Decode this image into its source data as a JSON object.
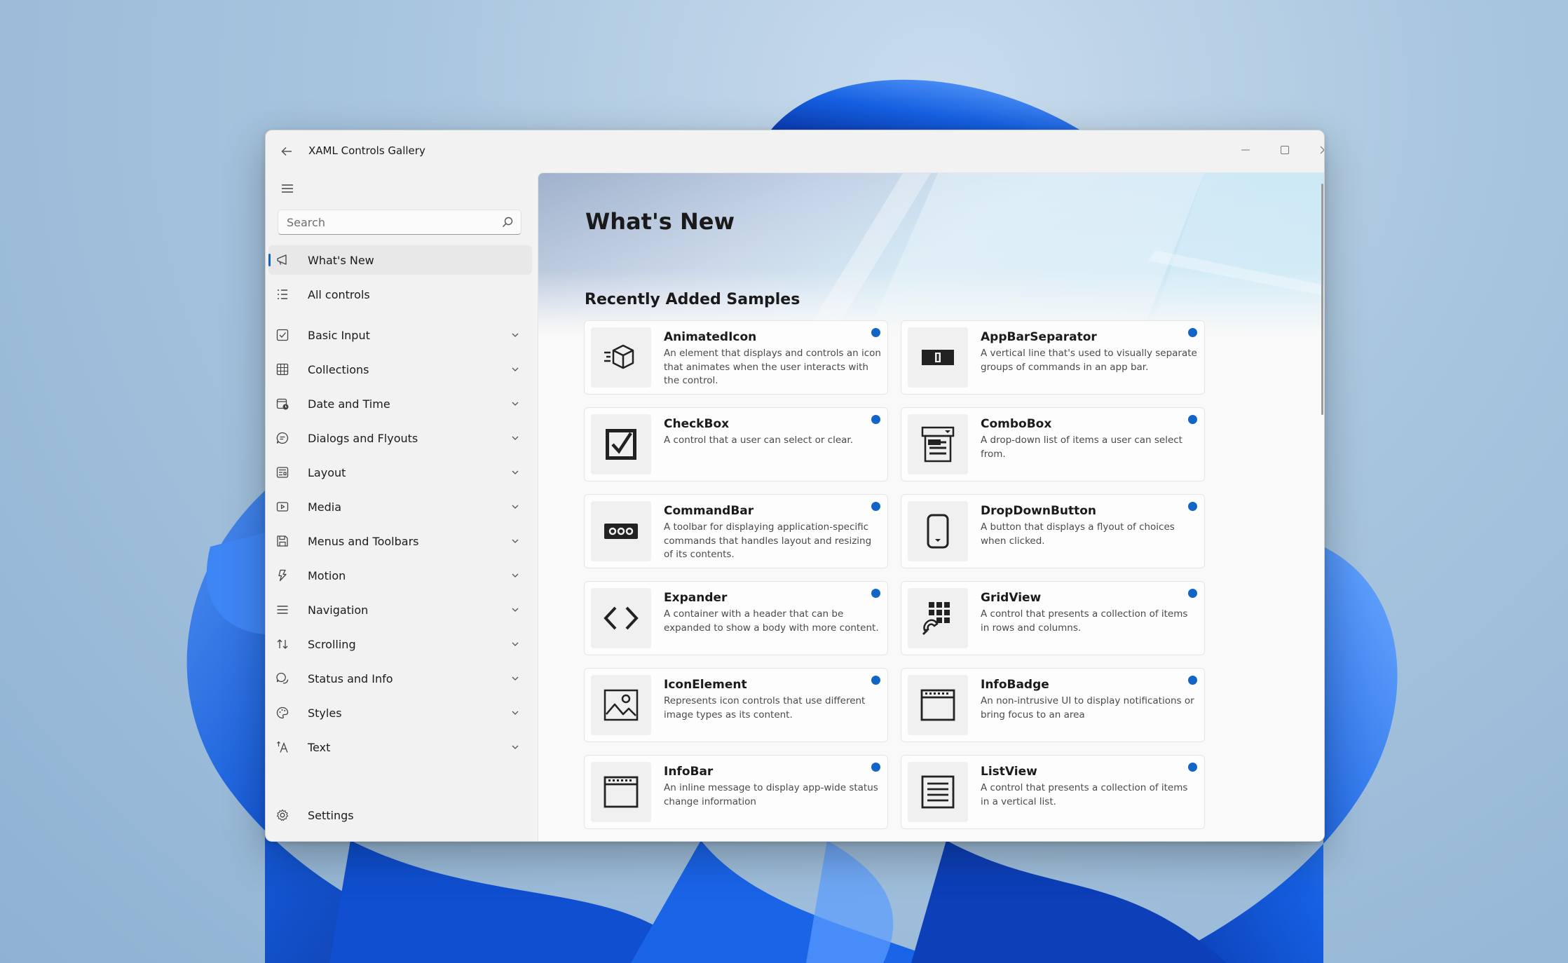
{
  "window": {
    "title": "XAML Controls Gallery",
    "icons": {
      "back": "back-arrow-icon",
      "minimize": "minimize-icon",
      "maximize": "maximize-icon",
      "close": "close-icon"
    }
  },
  "sidebar": {
    "menu_icon": "hamburger-icon",
    "search": {
      "placeholder": "Search",
      "value": "",
      "icon": "search-icon"
    },
    "top_items": [
      {
        "label": "What's New",
        "icon": "megaphone-icon",
        "selected": true
      },
      {
        "label": "All controls",
        "icon": "list-icon"
      }
    ],
    "items": [
      {
        "label": "Basic Input",
        "icon": "checkbox-icon"
      },
      {
        "label": "Collections",
        "icon": "grid-icon"
      },
      {
        "label": "Date and Time",
        "icon": "calendar-clock-icon"
      },
      {
        "label": "Dialogs and Flyouts",
        "icon": "chat-bubble-icon"
      },
      {
        "label": "Layout",
        "icon": "layout-icon"
      },
      {
        "label": "Media",
        "icon": "media-play-icon"
      },
      {
        "label": "Menus and Toolbars",
        "icon": "save-icon"
      },
      {
        "label": "Motion",
        "icon": "motion-icon"
      },
      {
        "label": "Navigation",
        "icon": "navigation-lines-icon"
      },
      {
        "label": "Scrolling",
        "icon": "scroll-arrows-icon"
      },
      {
        "label": "Status and Info",
        "icon": "status-chat-icon"
      },
      {
        "label": "Styles",
        "icon": "palette-icon"
      },
      {
        "label": "Text",
        "icon": "text-font-icon"
      }
    ],
    "settings": {
      "label": "Settings",
      "icon": "gear-icon"
    }
  },
  "main": {
    "title": "What's New",
    "section_title": "Recently Added Samples",
    "accent_color": "#1264c7",
    "cards": [
      {
        "title": "AnimatedIcon",
        "description": "An element that displays and controls an icon that animates when the user interacts with the control.",
        "icon": "animated-cube-icon"
      },
      {
        "title": "AppBarSeparator",
        "description": "A vertical line that's used to visually separate groups of commands in an app bar.",
        "icon": "appbar-separator-icon"
      },
      {
        "title": "CheckBox",
        "description": "A control that a user can select or clear.",
        "icon": "checkbox-checked-icon"
      },
      {
        "title": "ComboBox",
        "description": "A drop-down list of items a user can select from.",
        "icon": "combobox-icon"
      },
      {
        "title": "CommandBar",
        "description": "A toolbar for displaying application-specific commands that handles layout and resizing of its contents.",
        "icon": "commandbar-icon"
      },
      {
        "title": "DropDownButton",
        "description": "A button that displays a flyout of choices when clicked.",
        "icon": "dropdown-button-icon"
      },
      {
        "title": "Expander",
        "description": "A container with a header that can be expanded to show a body with more content.",
        "icon": "code-brackets-icon"
      },
      {
        "title": "GridView",
        "description": "A control that presents a collection of items in rows and columns.",
        "icon": "gridview-icon"
      },
      {
        "title": "IconElement",
        "description": "Represents icon controls that use different image types as its content.",
        "icon": "image-icon"
      },
      {
        "title": "InfoBadge",
        "description": "An non-intrusive UI to display notifications or bring focus to an area",
        "icon": "infobadge-icon"
      },
      {
        "title": "InfoBar",
        "description": "An inline message to display app-wide status change information",
        "icon": "infobar-icon"
      },
      {
        "title": "ListView",
        "description": "A control that presents a collection of items in a vertical list.",
        "icon": "listview-icon"
      }
    ]
  }
}
